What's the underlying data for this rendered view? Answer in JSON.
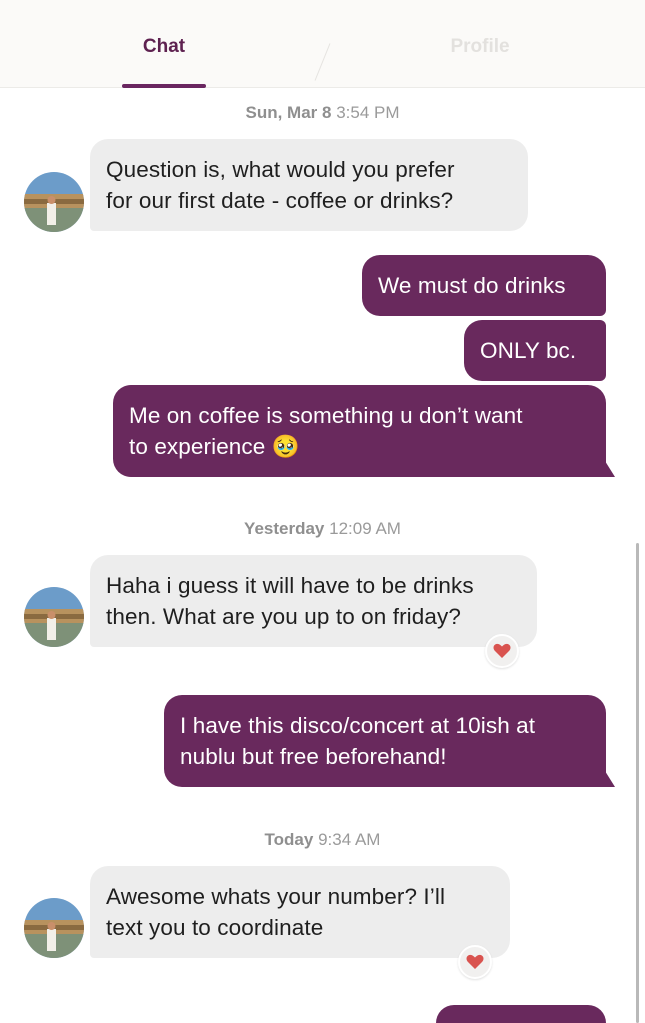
{
  "tabs": [
    {
      "label": "Chat",
      "active": true
    },
    {
      "label": "Profile",
      "active": false
    }
  ],
  "colors": {
    "accent": "#69295d",
    "incoming_bubble": "#ededed",
    "heart": "#d9534f"
  },
  "timestamps": [
    {
      "day": "Sun, Mar 8",
      "time": "3:54 PM"
    },
    {
      "day": "Yesterday",
      "time": "12:09 AM"
    },
    {
      "day": "Today",
      "time": "9:34 AM"
    }
  ],
  "messages": [
    {
      "sender": "them",
      "text": "Question is, what would you prefer\nfor our first date - coffee or drinks?"
    },
    {
      "sender": "me",
      "text": "We must do drinks"
    },
    {
      "sender": "me",
      "text": "ONLY bc."
    },
    {
      "sender": "me",
      "text": "Me on coffee is something u don’t want\nto experience 🥹"
    },
    {
      "sender": "them",
      "text": "Haha i guess it will have to be drinks\nthen. What are you up to on friday?",
      "reaction": "heart"
    },
    {
      "sender": "me",
      "text": "I have this disco/concert at 10ish at\nnublu but free beforehand!"
    },
    {
      "sender": "them",
      "text": "Awesome whats your number? I’ll\ntext you to coordinate",
      "reaction": "heart"
    },
    {
      "sender": "me",
      "text": ""
    }
  ]
}
